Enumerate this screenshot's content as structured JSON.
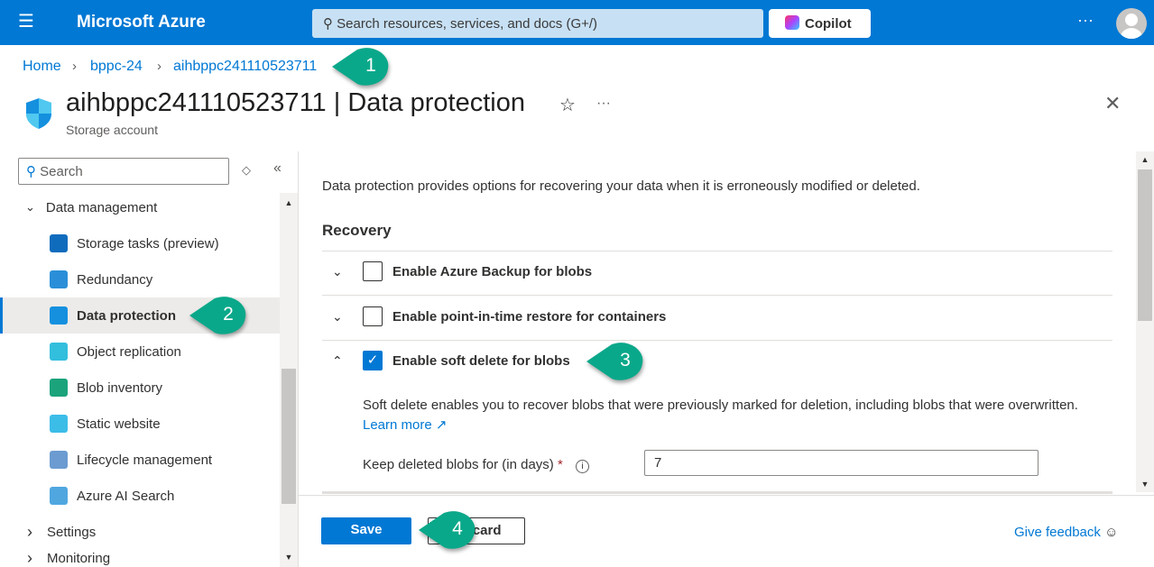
{
  "header": {
    "brand": "Microsoft Azure",
    "search_placeholder": "Search resources, services, and docs (G+/)",
    "copilot": "Copilot",
    "more": "···"
  },
  "breadcrumb": [
    "Home",
    "bppc-24",
    "aihbppc241110523711"
  ],
  "page": {
    "title": "aihbppc241110523711 | Data protection",
    "subtitle": "Storage account"
  },
  "sidebar": {
    "search_placeholder": "Search",
    "group": "Data management",
    "items": [
      {
        "label": "Storage tasks (preview)",
        "icon": "storage-tasks-icon",
        "color": "#0f6cbd"
      },
      {
        "label": "Redundancy",
        "icon": "globe-icon",
        "color": "#2a8fd8"
      },
      {
        "label": "Data protection",
        "icon": "shield-icon",
        "color": "#1490df",
        "selected": true
      },
      {
        "label": "Object replication",
        "icon": "object-replication-icon",
        "color": "#32bedd"
      },
      {
        "label": "Blob inventory",
        "icon": "blob-inventory-icon",
        "color": "#1ba37c"
      },
      {
        "label": "Static website",
        "icon": "static-website-icon",
        "color": "#3cbde8"
      },
      {
        "label": "Lifecycle management",
        "icon": "lifecycle-icon",
        "color": "#6b9bd1"
      },
      {
        "label": "Azure AI Search",
        "icon": "ai-search-icon",
        "color": "#50a7e0"
      }
    ],
    "settings": "Settings",
    "monitoring": "Monitoring"
  },
  "main": {
    "intro": "Data protection provides options for recovering your data when it is erroneously modified or deleted.",
    "recovery": "Recovery",
    "options": [
      {
        "label": "Enable Azure Backup for blobs",
        "checked": false
      },
      {
        "label": "Enable point-in-time restore for containers",
        "checked": false
      },
      {
        "label": "Enable soft delete for blobs",
        "checked": true
      }
    ],
    "soft_delete_desc": "Soft delete enables you to recover blobs that were previously marked for deletion, including blobs that were overwritten.",
    "learn_more": "Learn more",
    "keep_label": "Keep deleted blobs for (in days)",
    "required": "*",
    "keep_value": "7"
  },
  "footer": {
    "save": "Save",
    "discard": "Discard",
    "feedback": "Give feedback"
  },
  "callouts": [
    "1",
    "2",
    "3",
    "4"
  ],
  "colors": {
    "accent": "#0078d4",
    "callout": "#0aa88a"
  }
}
